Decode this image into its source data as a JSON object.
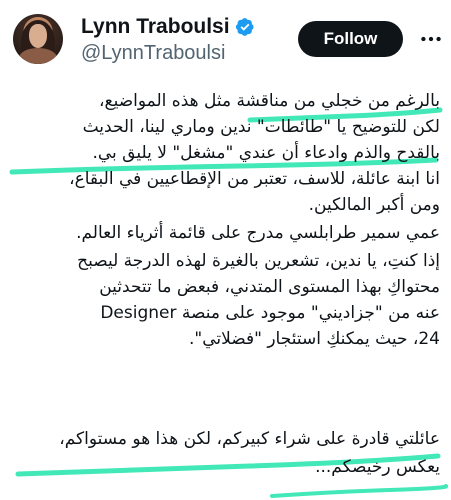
{
  "author": {
    "display_name": "Lynn Traboulsi",
    "handle": "@LynnTraboulsi",
    "verified": true,
    "avatar_icon": "profile-photo"
  },
  "actions": {
    "follow_label": "Follow",
    "more_icon": "more-horizontal-icon"
  },
  "tweet": {
    "lines": [
      "بالرغم من خجلي من مناقشة مثل هذه المواضيع،",
      "لكن للتوضيح يا \"طائطات\" ندين وماري لينا، الحديث",
      "بالقدح والذم وادعاء أن عندي \"مشغل\" لا يليق بي.",
      "انا ابنة عائلة، للاسف، تعتبر من الإقطاعيين في البقاع،",
      "ومن أكبر المالكين.",
      "عمي سمير طرابلسي  مدرج على قائمة أثرياء العالم.",
      "إذا كنتِ، يا ندين، تشعرين بالغيرة لهذه الدرجة ليصبح",
      "محتواكِ بهذا المستوى المتدني، فبعض ما تتحدثين",
      "عنه من \"جزاديني\" موجود على منصة Designer",
      "24، حيث يمكنكِ استئجار \"فضلاتي\".",
      "",
      "عائلتي قادرة على شراء كبيركم، لكن هذا هو مستواكم،",
      "يعكس رخيصكم..."
    ]
  },
  "colors": {
    "highlight": "#43e8b8",
    "verified": "#1d9bf0",
    "follow_bg": "#0f1419",
    "follow_text": "#ffffff",
    "handle": "#536471"
  }
}
